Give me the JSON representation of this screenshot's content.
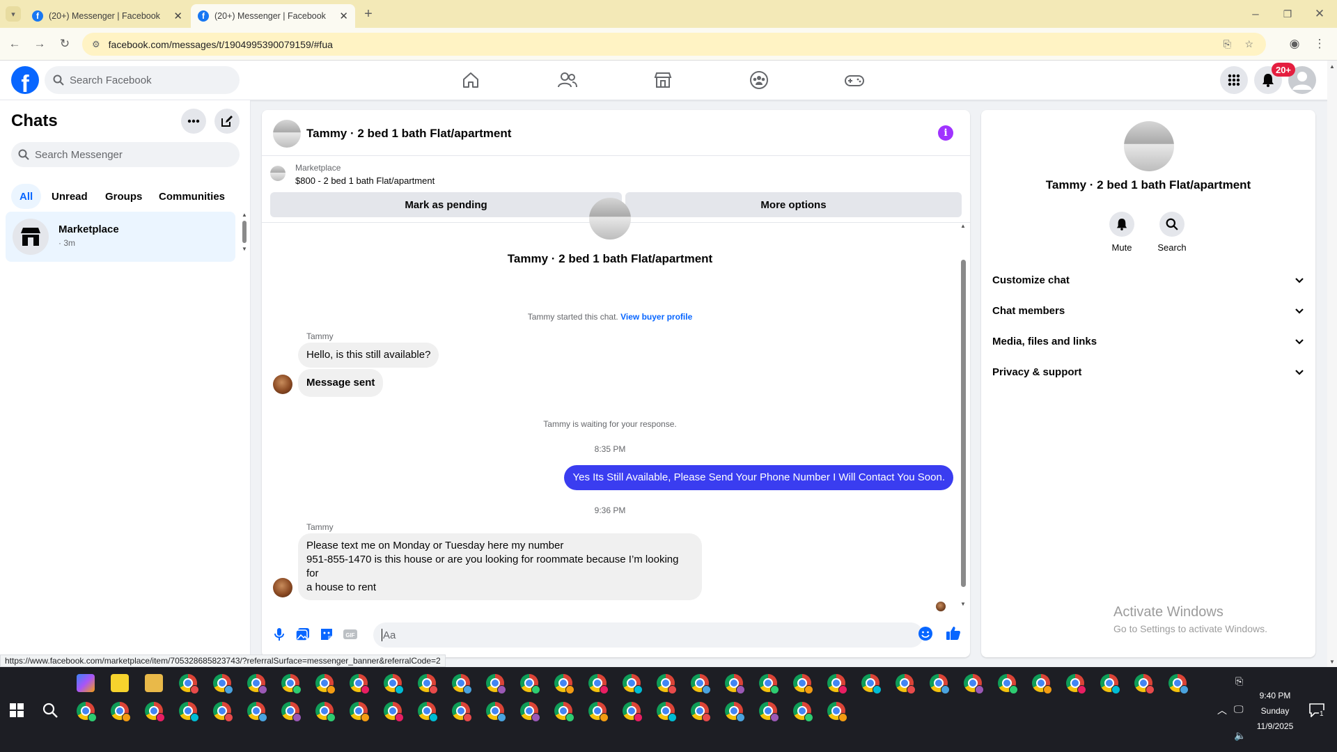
{
  "browser": {
    "tabs": [
      {
        "title": "(20+) Messenger | Facebook",
        "active": false
      },
      {
        "title": "(20+) Messenger | Facebook",
        "active": true
      }
    ],
    "url": "facebook.com/messages/t/1904995390079159/#fua",
    "status_url": "https://www.facebook.com/marketplace/item/705328685823743/?referralSurface=messenger_banner&referralCode=2"
  },
  "fb_header": {
    "logo": "f",
    "search_placeholder": "Search Facebook",
    "nav_icons": [
      "home-icon",
      "friends-icon",
      "marketplace-icon",
      "groups-icon",
      "gaming-icon"
    ],
    "notification_badge": "20+"
  },
  "sidebar": {
    "title": "Chats",
    "search_placeholder": "Search Messenger",
    "filters": [
      "All",
      "Unread",
      "Groups",
      "Communities"
    ],
    "active_filter": "All",
    "chats": [
      {
        "name": "Marketplace",
        "time": "· 3m"
      }
    ]
  },
  "conversation": {
    "title": "Tammy · 2 bed 1 bath Flat/apartment",
    "banner": {
      "label": "Marketplace",
      "item": "$800 - 2 bed 1 bath Flat/apartment",
      "btn_pending": "Mark as pending",
      "btn_more": "More options"
    },
    "intro_title": "Tammy · 2 bed 1 bath Flat/apartment",
    "started_text": "Tammy started this chat.",
    "buyer_profile_link": "View buyer profile",
    "messages": {
      "m1_sender": "Tammy",
      "m1_text": "Hello, is this still available?",
      "m2_text": "Message sent",
      "waiting_text": "Tammy is waiting for your response.",
      "time1": "8:35 PM",
      "m3_text": "Yes Its Still Available, Please Send Your Phone Number I Will Contact You Soon.",
      "time2": "9:36 PM",
      "m4_sender": "Tammy",
      "m4_line1": "Please text me on Monday or Tuesday here my number",
      "m4_line2": "951-855-1470  is this house or are you looking for roommate because I’m looking for",
      "m4_line3": "a house to rent"
    },
    "composer_placeholder": "Aa"
  },
  "info_panel": {
    "name": "Tammy · 2 bed 1 bath Flat/apartment",
    "actions": [
      {
        "label": "Mute"
      },
      {
        "label": "Search"
      }
    ],
    "sections": [
      "Customize chat",
      "Chat members",
      "Media, files and links",
      "Privacy & support"
    ],
    "watermark_line1": "Activate Windows",
    "watermark_line2": "Go to Settings to activate Windows."
  },
  "taskbar": {
    "time": "9:40 PM",
    "day": "Sunday",
    "date": "11/9/2025",
    "notification_count": "1"
  },
  "colors": {
    "fb_blue": "#0866ff",
    "my_bubble": "#3a3df0",
    "badge_red": "#e41e3f",
    "tab_strip": "#f3e9b7",
    "taskbar": "#1d1e24"
  }
}
